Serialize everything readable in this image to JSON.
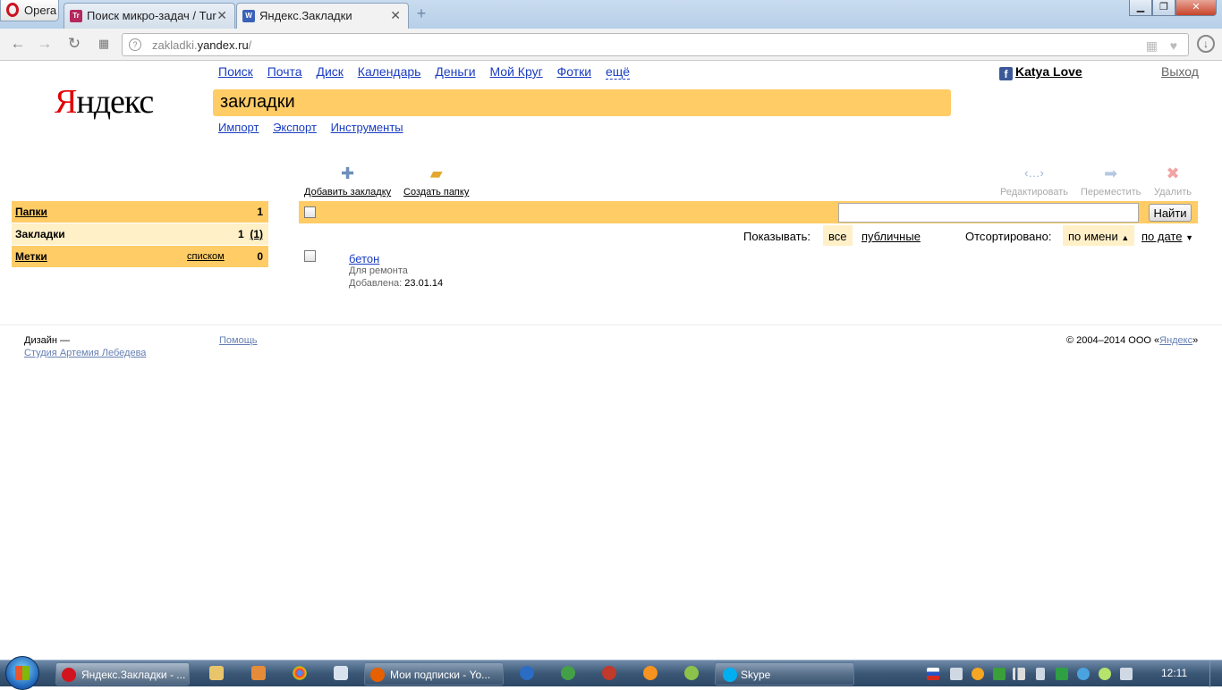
{
  "browser": {
    "menu_label": "Opera",
    "tabs": [
      {
        "title": "Поиск микро-задач / Tur",
        "favicon": "Tr"
      },
      {
        "title": "Яндекс.Закладки",
        "favicon": "W"
      }
    ],
    "address": {
      "host_prefix": "zakladki.",
      "host_main": "yandex.ru",
      "path": "/"
    }
  },
  "header": {
    "logo": {
      "first": "Я",
      "rest": "ндекс"
    },
    "services": [
      "Поиск",
      "Почта",
      "Диск",
      "Календарь",
      "Деньги",
      "Мой Круг",
      "Фотки",
      "ещё"
    ],
    "user_name": "Katya Love",
    "logout": "Выход",
    "service_title": "закладки",
    "subnav": [
      "Импорт",
      "Экспорт",
      "Инструменты"
    ]
  },
  "actions": {
    "add_bookmark": "Добавить закладку",
    "create_folder": "Создать папку",
    "edit": "Редактировать",
    "move": "Переместить",
    "delete": "Удалить"
  },
  "sidebar": {
    "folders": {
      "label": "Папки",
      "count": "1"
    },
    "bookmarks": {
      "label": "Закладки",
      "count": "1",
      "count_link": "(1)"
    },
    "tags": {
      "label": "Метки",
      "extra": "списком",
      "count": "0"
    }
  },
  "list": {
    "search_button": "Найти",
    "show_label": "Показывать:",
    "show_all": "все",
    "show_public": "публичные",
    "sorted_label": "Отсортировано:",
    "sort_by_name": "по имени",
    "sort_by_date": "по дате",
    "items": [
      {
        "title": "бетон",
        "description": "Для ремонта",
        "added_label": "Добавлена:",
        "added_date": "23.01.14"
      }
    ]
  },
  "footer": {
    "design_label": "Дизайн —",
    "design_link": "Студия Артемия Лебедева",
    "help": "Помощь",
    "copyright": "© 2004–2014  ООО «",
    "copyright_link": "Яндекс",
    "copyright_end": "»"
  },
  "taskbar": {
    "items": [
      "Яндекс.Закладки - ...",
      "Мои подписки - Yo...",
      "Skype"
    ],
    "clock": "12:11"
  },
  "colors": {
    "accent": "#ffcc66",
    "accent_light": "#fff0c8",
    "link": "#1a3dc1",
    "logo_red": "#e20000"
  }
}
